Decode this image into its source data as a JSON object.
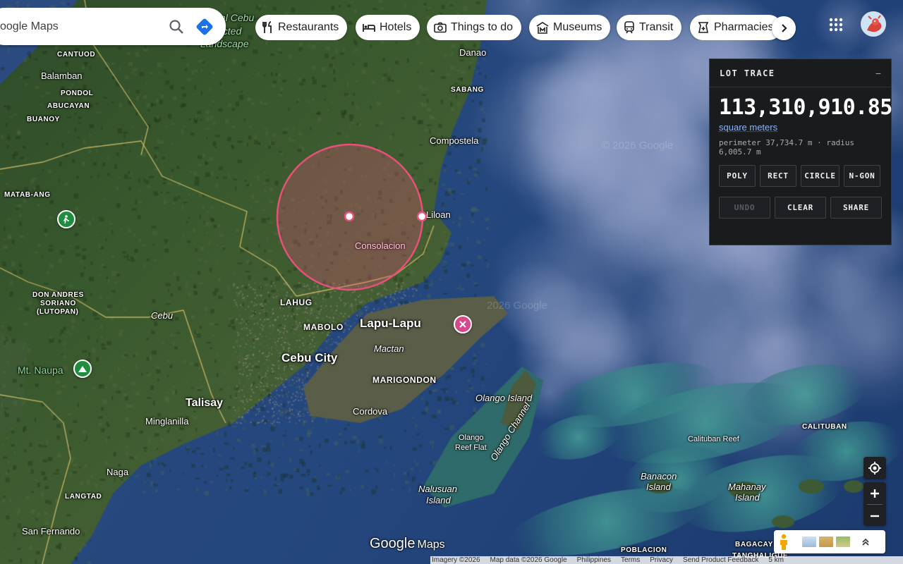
{
  "search": {
    "text": "oogle Maps"
  },
  "chips": [
    {
      "label": "Restaurants",
      "icon": "fork-knife-icon"
    },
    {
      "label": "Hotels",
      "icon": "bed-icon"
    },
    {
      "label": "Things to do",
      "icon": "camera-icon"
    },
    {
      "label": "Museums",
      "icon": "museum-icon"
    },
    {
      "label": "Transit",
      "icon": "train-icon"
    },
    {
      "label": "Pharmacies",
      "icon": "pharmacy-icon"
    }
  ],
  "panel": {
    "title": "LOT TRACE",
    "minimize": "−",
    "area": "113,310,910.85",
    "unit": "square meters",
    "stats": "perimeter 37,734.7 m · radius 6,005.7 m",
    "shape_buttons": [
      "POLY",
      "RECT",
      "CIRCLE",
      "N-GON"
    ],
    "undo": "UNDO",
    "clear": "CLEAR",
    "share": "SHARE"
  },
  "map": {
    "labels": {
      "cantuod": "CANTUOD",
      "balamban": "Balamban",
      "pondol": "PONDOL",
      "abucayan": "ABUCAYAN",
      "buanoy": "BUANOY",
      "matab_ang": "MATAB-ANG",
      "don_andres": "DON ANDRES",
      "soriano": "SORIANO",
      "lutopan": "(LUTOPAN)",
      "cebu_road": "Cebu",
      "mt_naupa": "Mt. Naupa",
      "talisay": "Talisay",
      "minglanilla": "Minglanilla",
      "naga": "Naga",
      "langtad": "LANGTAD",
      "san_fernando": "San Fernando",
      "protected_1": "al Cebu",
      "protected_2": "ected",
      "protected_3": "Landscape",
      "danao": "Danao",
      "sabang": "SABANG",
      "compostela": "Compostela",
      "liloan": "Liloan",
      "consolacion": "Consolacion",
      "lahug": "LAHUG",
      "mabolo": "MABOLO",
      "lapu_lapu": "Lapu-Lapu",
      "cebu_city": "Cebu City",
      "mactan": "Mactan",
      "marigondon": "MARIGONDON",
      "cordova": "Cordova",
      "olango_island": "Olango Island",
      "olango_reef_1": "Olango",
      "olango_reef_2": "Reef Flat",
      "olango_channel": "Olango Channel",
      "nalusuan_1": "Nalusuan",
      "nalusuan_2": "Island",
      "calituban": "CALITUBAN",
      "calituban_reef": "Calituban Reef",
      "banacon_1": "Banacon",
      "banacon_2": "Island",
      "mahanay_1": "Mahanay",
      "mahanay_2": "Island",
      "bagacay": "BAGACAY",
      "poblacion": "POBLACION",
      "tanghaligue": "TANGHALIGUE"
    },
    "watermark": "© 2026 Google",
    "watermark2": "2026 Google",
    "logo_google": "Google",
    "logo_maps": "Maps"
  },
  "attribution": [
    "Imagery ©2026",
    "Map data ©2026 Google",
    "Philippines",
    "Terms",
    "Privacy",
    "Send Product Feedback",
    "5 km"
  ],
  "colors": {
    "circle": "#e8507a",
    "panel_bg": "#1a1b1d",
    "accent_link": "#8ab4f8"
  }
}
